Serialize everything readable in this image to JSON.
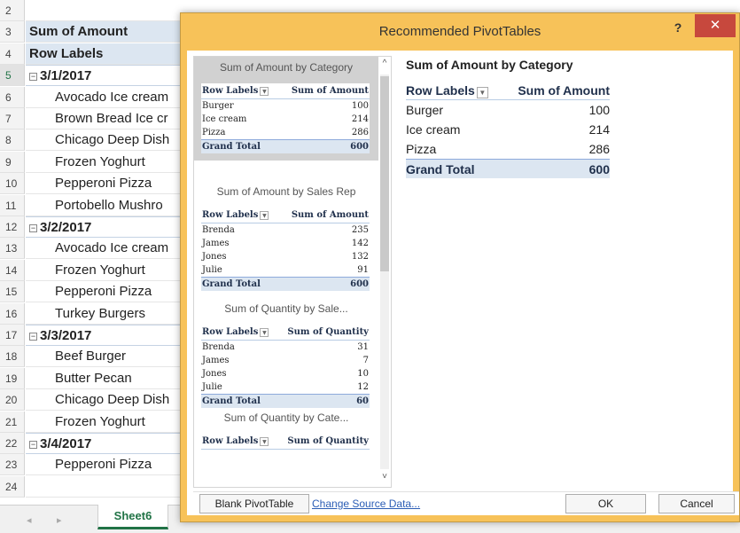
{
  "sheet": {
    "rows": [
      {
        "num": "2",
        "text": "",
        "kind": "blank"
      },
      {
        "num": "3",
        "text": "Sum of Amount",
        "kind": "hdr"
      },
      {
        "num": "4",
        "text": "Row Labels",
        "kind": "hdr"
      },
      {
        "num": "5",
        "text": "3/1/2017",
        "kind": "date"
      },
      {
        "num": "6",
        "text": "Avocado Ice cream",
        "kind": "item"
      },
      {
        "num": "7",
        "text": "Brown Bread Ice cr",
        "kind": "item"
      },
      {
        "num": "8",
        "text": "Chicago Deep Dish",
        "kind": "item"
      },
      {
        "num": "9",
        "text": "Frozen Yoghurt",
        "kind": "item"
      },
      {
        "num": "10",
        "text": "Pepperoni Pizza",
        "kind": "item"
      },
      {
        "num": "11",
        "text": "Portobello Mushro",
        "kind": "item"
      },
      {
        "num": "12",
        "text": "3/2/2017",
        "kind": "date"
      },
      {
        "num": "13",
        "text": "Avocado Ice cream",
        "kind": "item"
      },
      {
        "num": "14",
        "text": "Frozen Yoghurt",
        "kind": "item"
      },
      {
        "num": "15",
        "text": "Pepperoni Pizza",
        "kind": "item"
      },
      {
        "num": "16",
        "text": "Turkey Burgers",
        "kind": "item"
      },
      {
        "num": "17",
        "text": "3/3/2017",
        "kind": "date"
      },
      {
        "num": "18",
        "text": "Beef Burger",
        "kind": "item"
      },
      {
        "num": "19",
        "text": "Butter Pecan",
        "kind": "item"
      },
      {
        "num": "20",
        "text": "Chicago Deep Dish",
        "kind": "item"
      },
      {
        "num": "21",
        "text": "Frozen Yoghurt",
        "kind": "item"
      },
      {
        "num": "22",
        "text": "3/4/2017",
        "kind": "date"
      },
      {
        "num": "23",
        "text": "Pepperoni Pizza",
        "kind": "item"
      },
      {
        "num": "24",
        "text": "",
        "kind": "blank"
      }
    ],
    "active_row": "5",
    "collapse_symbol": "−",
    "tab_name": "Sheet6",
    "tab_prev": "◂",
    "tab_next": "▸"
  },
  "dialog": {
    "title": "Recommended PivotTables",
    "help": "?",
    "close": "✕",
    "accent_color": "#f7c259",
    "dropdown_glyph": "▼",
    "recommendations": [
      {
        "title": "Sum of Amount by Category",
        "selected": true,
        "head": [
          "Row Labels",
          "Sum of Amount"
        ],
        "rows": [
          [
            "Burger",
            "100"
          ],
          [
            "Ice cream",
            "214"
          ],
          [
            "Pizza",
            "286"
          ]
        ],
        "total": [
          "Grand Total",
          "600"
        ]
      },
      {
        "title": "Sum of Amount by Sales Rep",
        "selected": false,
        "head": [
          "Row Labels",
          "Sum of Amount"
        ],
        "rows": [
          [
            "Brenda",
            "235"
          ],
          [
            "James",
            "142"
          ],
          [
            "Jones",
            "132"
          ],
          [
            "Julie",
            "91"
          ]
        ],
        "total": [
          "Grand Total",
          "600"
        ]
      },
      {
        "title": "Sum of Quantity by Sale...",
        "selected": false,
        "head": [
          "Row Labels",
          "Sum of Quantity"
        ],
        "rows": [
          [
            "Brenda",
            "31"
          ],
          [
            "James",
            "7"
          ],
          [
            "Jones",
            "10"
          ],
          [
            "Julie",
            "12"
          ]
        ],
        "total": [
          "Grand Total",
          "60"
        ]
      },
      {
        "title": "Sum of Quantity by Cate...",
        "selected": false,
        "head": [
          "Row Labels",
          "Sum of Quantity"
        ],
        "rows": [],
        "total": []
      }
    ],
    "preview": {
      "title": "Sum of Amount by Category",
      "head": [
        "Row Labels",
        "Sum of Amount"
      ],
      "rows": [
        [
          "Burger",
          "100"
        ],
        [
          "Ice cream",
          "214"
        ],
        [
          "Pizza",
          "286"
        ]
      ],
      "total": [
        "Grand Total",
        "600"
      ]
    },
    "scroll_up": "^",
    "scroll_down": "˅",
    "footer": {
      "blank_label": "Blank PivotTable",
      "change_source_label": "Change Source Data...",
      "ok_label": "OK",
      "cancel_label": "Cancel"
    }
  }
}
